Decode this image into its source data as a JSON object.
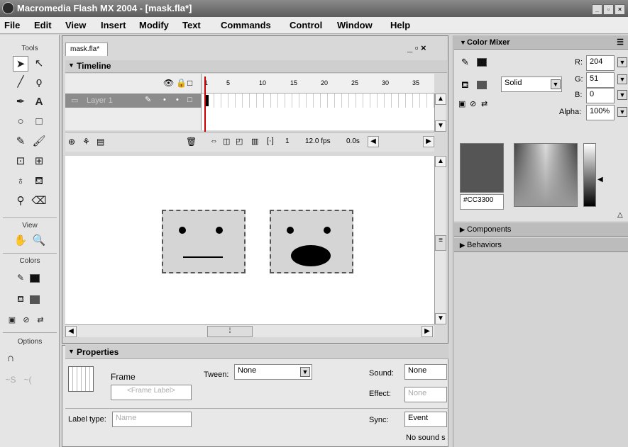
{
  "window": {
    "title": "Macromedia Flash MX 2004 - [mask.fla*]"
  },
  "menu": [
    "File",
    "Edit",
    "View",
    "Insert",
    "Modify",
    "Text",
    "Commands",
    "Control",
    "Window",
    "Help"
  ],
  "tools": {
    "header": "Tools",
    "view_header": "View",
    "colors_header": "Colors",
    "options_header": "Options"
  },
  "document": {
    "tab": "mask.fla*",
    "win_controls": "_ ▫ ×"
  },
  "timeline": {
    "header": "Timeline",
    "frame_numbers": [
      "1",
      "5",
      "10",
      "15",
      "20",
      "25",
      "30",
      "35"
    ],
    "layer_name": "Layer 1",
    "current_frame": "1",
    "fps": "12.0 fps",
    "time": "0.0s"
  },
  "properties": {
    "header": "Properties",
    "frame_label": "Frame",
    "frame_label_placeholder": "<Frame Label>",
    "tween_label": "Tween:",
    "tween_value": "None",
    "sound_label": "Sound:",
    "sound_value": "None",
    "effect_label": "Effect:",
    "effect_value": "None",
    "label_type_label": "Label type:",
    "label_type_value": "Name",
    "sync_label": "Sync:",
    "sync_value": "Event",
    "no_sound": "No sound s"
  },
  "color_mixer": {
    "header": "Color Mixer",
    "fill_type": "Solid",
    "r_label": "R:",
    "r_value": "204",
    "g_label": "G:",
    "g_value": "51",
    "b_label": "B:",
    "b_value": "0",
    "alpha_label": "Alpha:",
    "alpha_value": "100%",
    "hex": "#CC3300"
  },
  "panels": {
    "components": "Components",
    "behaviors": "Behaviors"
  },
  "colors": {
    "swatch_preview": "#555555",
    "titlebar": "#6e6e6e"
  }
}
